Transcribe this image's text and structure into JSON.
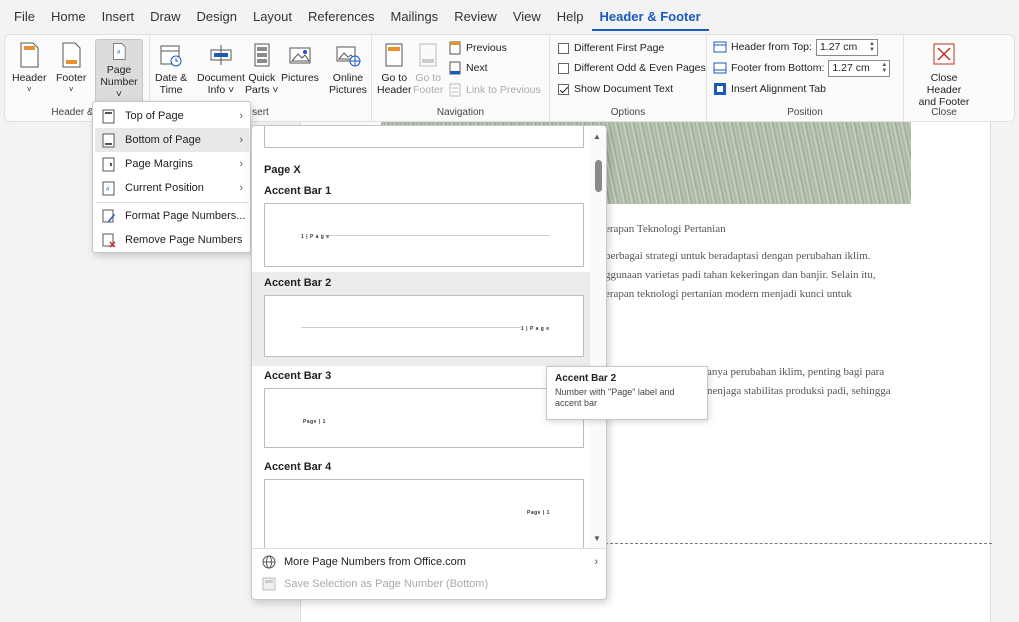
{
  "tabs": [
    "File",
    "Home",
    "Insert",
    "Draw",
    "Design",
    "Layout",
    "References",
    "Mailings",
    "Review",
    "View",
    "Help",
    "Header & Footer"
  ],
  "active_tab": "Header & Footer",
  "ribbon": {
    "header_footer_group": {
      "label": "Header & F",
      "header": "Header",
      "footer": "Footer",
      "page_number_line1": "Page",
      "page_number_line2": "Number ˅"
    },
    "insert_group": {
      "label": "sert",
      "date_time_1": "Date &",
      "date_time_2": "Time",
      "doc_info_1": "Document",
      "doc_info_2": "Info ˅",
      "quick_parts_1": "Quick",
      "quick_parts_2": "Parts ˅",
      "pictures": "Pictures",
      "online_pictures_1": "Online",
      "online_pictures_2": "Pictures"
    },
    "navigation_group": {
      "label": "Navigation",
      "goto_header_1": "Go to",
      "goto_header_2": "Header",
      "goto_footer_1": "Go to",
      "goto_footer_2": "Footer",
      "previous": "Previous",
      "next": "Next",
      "link_to_previous": "Link to Previous"
    },
    "options_group": {
      "label": "Options",
      "different_first_page": "Different First Page",
      "different_odd_even": "Different Odd & Even Pages",
      "show_document_text": "Show Document Text"
    },
    "position_group": {
      "label": "Position",
      "header_from_top": "Header from Top:",
      "header_from_top_value": "1.27 cm",
      "footer_from_bottom": "Footer from Bottom:",
      "footer_from_bottom_value": "1.27 cm",
      "insert_alignment_tab": "Insert Alignment Tab"
    },
    "close_group": {
      "label": "Close",
      "close_line1": "Close Header",
      "close_line2": "and Footer"
    }
  },
  "page_number_menu": {
    "items": [
      {
        "label": "Top of Page",
        "icon": "top-of-page-icon"
      },
      {
        "label": "Bottom of Page",
        "icon": "bottom-of-page-icon"
      },
      {
        "label": "Page Margins",
        "icon": "page-margins-icon"
      },
      {
        "label": "Current Position",
        "icon": "current-position-icon"
      },
      {
        "label": "Format Page Numbers...",
        "icon": "format-page-numbers-icon"
      },
      {
        "label": "Remove Page Numbers",
        "icon": "remove-page-numbers-icon"
      }
    ]
  },
  "gallery": {
    "section_title": "Page X",
    "entries": [
      {
        "title": "Accent Bar 1",
        "sample": "1 | P a g e"
      },
      {
        "title": "Accent Bar 2",
        "sample": "1 | P a g e"
      },
      {
        "title": "Accent Bar 3",
        "sample": "Page | 1"
      },
      {
        "title": "Accent Bar 4",
        "sample": "Page | 1"
      }
    ],
    "more": "More Page Numbers from Office.com",
    "save_selection": "Save Selection as Page Number (Bottom)"
  },
  "tooltip": {
    "title": "Accent Bar 2",
    "description": "Number with \"Page\" label and accent bar"
  },
  "document": {
    "line1": "erapan Teknologi Pertanian",
    "line2": "berbagai strategi untuk beradaptasi dengan perubahan iklim.",
    "line3": "ggunaan varietas padi tahan kekeringan dan banjir. Selain itu,",
    "line4": "erapan  teknologi  pertanian  modern  menjadi  kunci  untuk",
    "line5": "anya perubahan iklim, penting bagi para",
    "line6": "nenjaga stabilitas produksi padi, sehingga"
  },
  "colors": {
    "accent": "#185abd",
    "close_red": "#c42b1c"
  }
}
